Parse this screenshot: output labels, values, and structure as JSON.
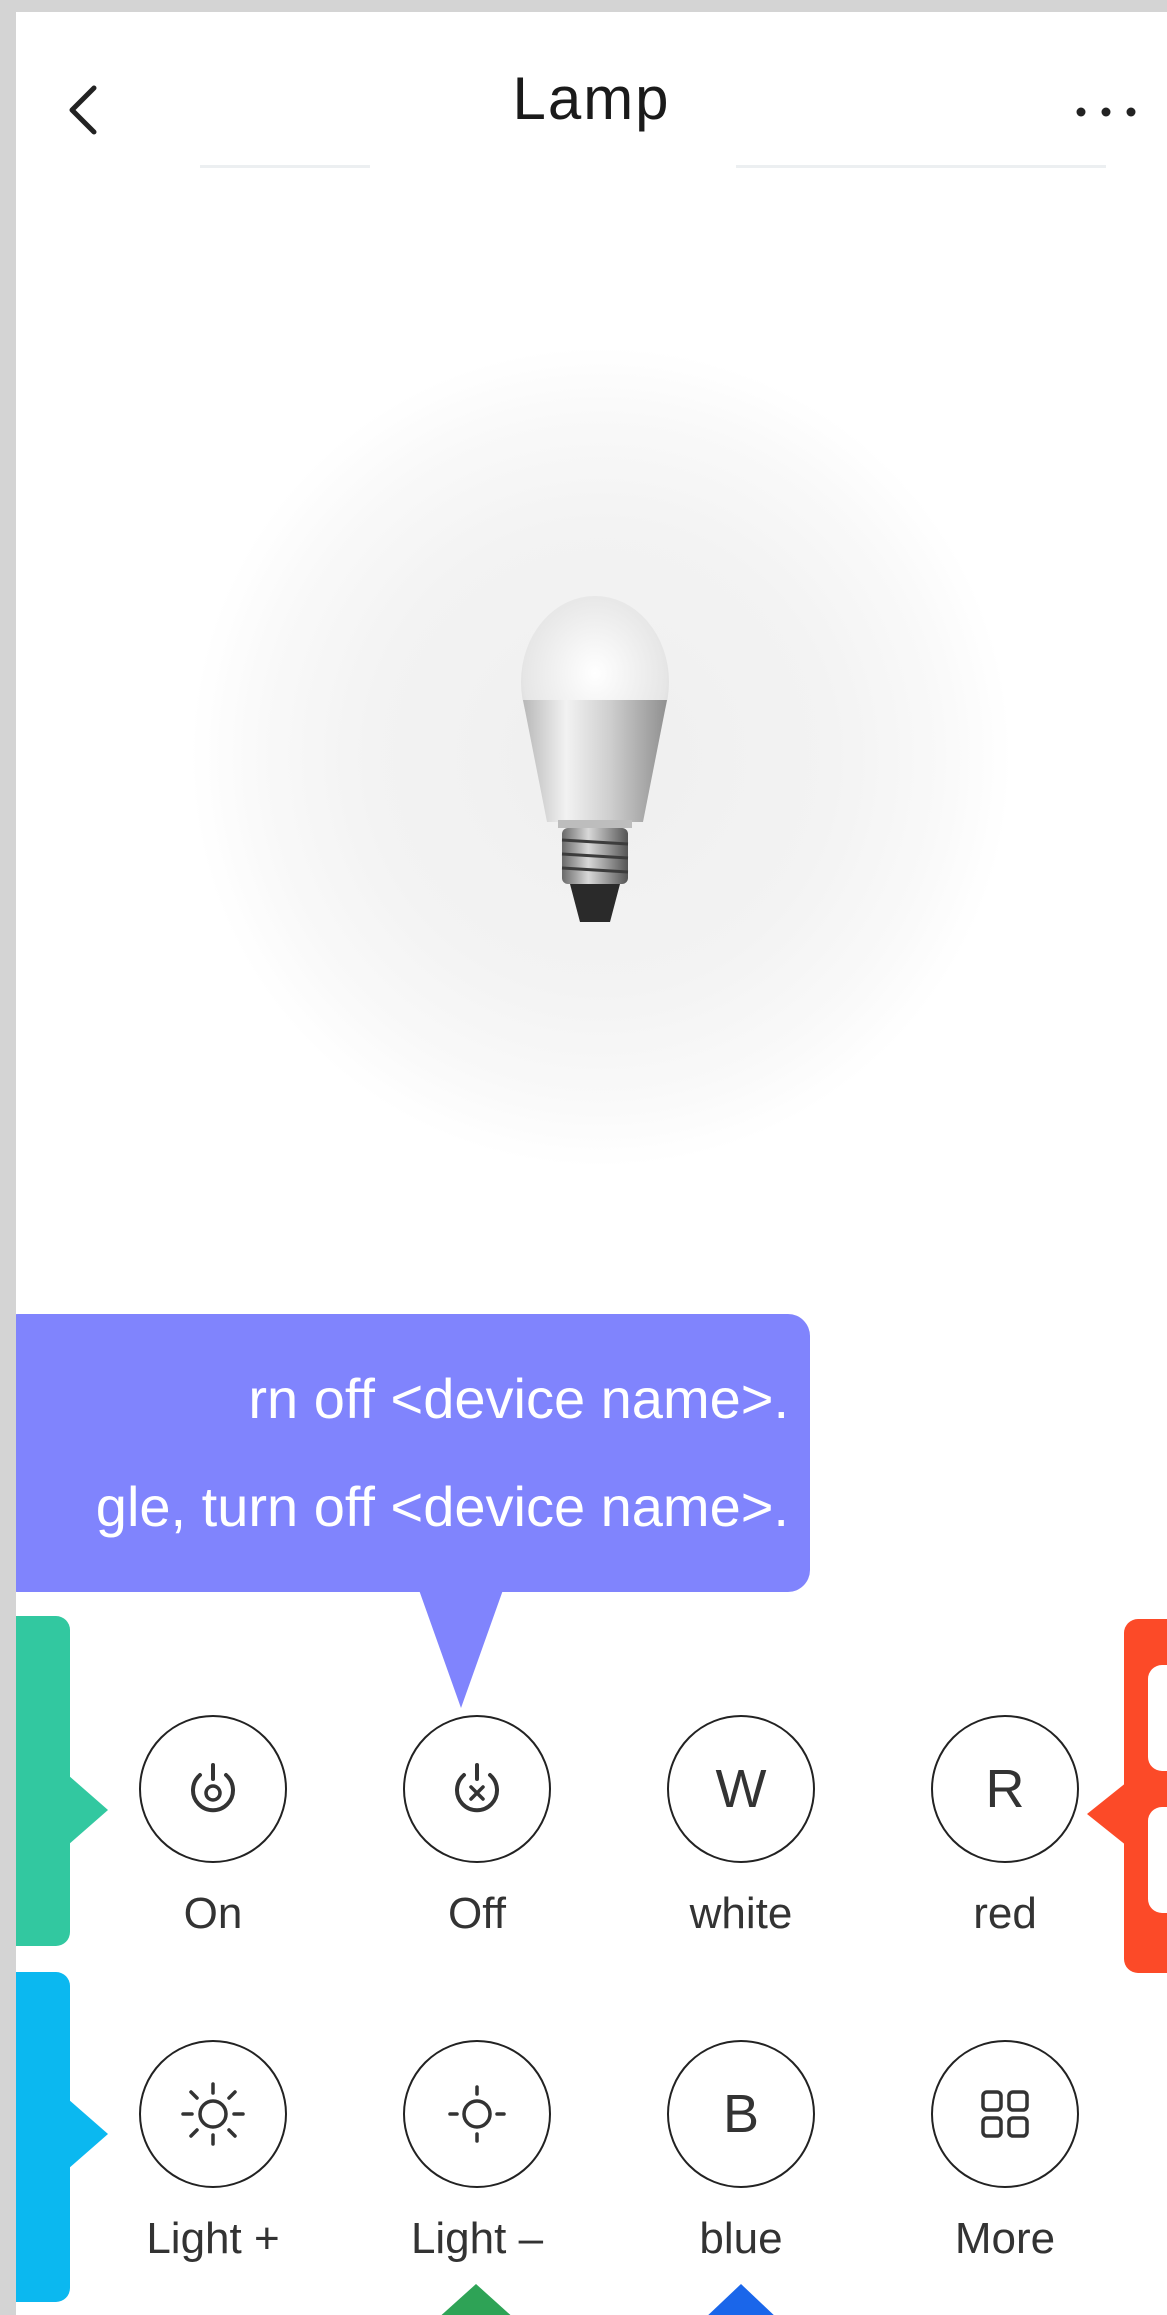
{
  "header": {
    "title": "Lamp",
    "back_icon": "chevron-left-icon",
    "more_icon": "more-dots-icon"
  },
  "device_image": {
    "icon": "light-bulb-icon"
  },
  "tooltip": {
    "line1": "rn off <device name>.",
    "line2": "gle, turn off <device name>.",
    "color": "#8084fd"
  },
  "controls": [
    {
      "label": "On",
      "icon": "power-on-icon"
    },
    {
      "label": "Off",
      "icon": "power-off-icon"
    },
    {
      "label": "white",
      "icon": "letter-w-icon",
      "glyph": "W"
    },
    {
      "label": "red",
      "icon": "letter-r-icon",
      "glyph": "R"
    },
    {
      "label": "Light +",
      "icon": "brightness-up-icon"
    },
    {
      "label": "Light –",
      "icon": "brightness-down-icon"
    },
    {
      "label": "blue",
      "icon": "letter-b-icon",
      "glyph": "B"
    },
    {
      "label": "More",
      "icon": "grid-icon"
    }
  ],
  "colors": {
    "teal_tab": "#32c8a0",
    "cyan_tab": "#0bb8f0",
    "red_tab": "#fc4a28",
    "green_arrow": "#2ea356",
    "blue_arrow": "#1a66ea"
  }
}
